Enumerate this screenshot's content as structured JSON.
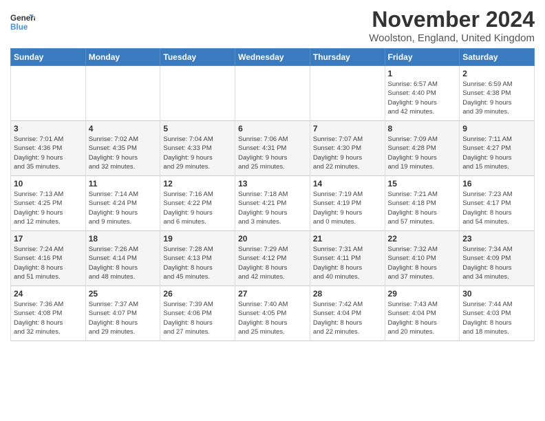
{
  "header": {
    "logo_line1": "General",
    "logo_line2": "Blue",
    "title": "November 2024",
    "subtitle": "Woolston, England, United Kingdom"
  },
  "days_of_week": [
    "Sunday",
    "Monday",
    "Tuesday",
    "Wednesday",
    "Thursday",
    "Friday",
    "Saturday"
  ],
  "weeks": [
    [
      {
        "day": "",
        "info": ""
      },
      {
        "day": "",
        "info": ""
      },
      {
        "day": "",
        "info": ""
      },
      {
        "day": "",
        "info": ""
      },
      {
        "day": "",
        "info": ""
      },
      {
        "day": "1",
        "info": "Sunrise: 6:57 AM\nSunset: 4:40 PM\nDaylight: 9 hours\nand 42 minutes."
      },
      {
        "day": "2",
        "info": "Sunrise: 6:59 AM\nSunset: 4:38 PM\nDaylight: 9 hours\nand 39 minutes."
      }
    ],
    [
      {
        "day": "3",
        "info": "Sunrise: 7:01 AM\nSunset: 4:36 PM\nDaylight: 9 hours\nand 35 minutes."
      },
      {
        "day": "4",
        "info": "Sunrise: 7:02 AM\nSunset: 4:35 PM\nDaylight: 9 hours\nand 32 minutes."
      },
      {
        "day": "5",
        "info": "Sunrise: 7:04 AM\nSunset: 4:33 PM\nDaylight: 9 hours\nand 29 minutes."
      },
      {
        "day": "6",
        "info": "Sunrise: 7:06 AM\nSunset: 4:31 PM\nDaylight: 9 hours\nand 25 minutes."
      },
      {
        "day": "7",
        "info": "Sunrise: 7:07 AM\nSunset: 4:30 PM\nDaylight: 9 hours\nand 22 minutes."
      },
      {
        "day": "8",
        "info": "Sunrise: 7:09 AM\nSunset: 4:28 PM\nDaylight: 9 hours\nand 19 minutes."
      },
      {
        "day": "9",
        "info": "Sunrise: 7:11 AM\nSunset: 4:27 PM\nDaylight: 9 hours\nand 15 minutes."
      }
    ],
    [
      {
        "day": "10",
        "info": "Sunrise: 7:13 AM\nSunset: 4:25 PM\nDaylight: 9 hours\nand 12 minutes."
      },
      {
        "day": "11",
        "info": "Sunrise: 7:14 AM\nSunset: 4:24 PM\nDaylight: 9 hours\nand 9 minutes."
      },
      {
        "day": "12",
        "info": "Sunrise: 7:16 AM\nSunset: 4:22 PM\nDaylight: 9 hours\nand 6 minutes."
      },
      {
        "day": "13",
        "info": "Sunrise: 7:18 AM\nSunset: 4:21 PM\nDaylight: 9 hours\nand 3 minutes."
      },
      {
        "day": "14",
        "info": "Sunrise: 7:19 AM\nSunset: 4:19 PM\nDaylight: 9 hours\nand 0 minutes."
      },
      {
        "day": "15",
        "info": "Sunrise: 7:21 AM\nSunset: 4:18 PM\nDaylight: 8 hours\nand 57 minutes."
      },
      {
        "day": "16",
        "info": "Sunrise: 7:23 AM\nSunset: 4:17 PM\nDaylight: 8 hours\nand 54 minutes."
      }
    ],
    [
      {
        "day": "17",
        "info": "Sunrise: 7:24 AM\nSunset: 4:16 PM\nDaylight: 8 hours\nand 51 minutes."
      },
      {
        "day": "18",
        "info": "Sunrise: 7:26 AM\nSunset: 4:14 PM\nDaylight: 8 hours\nand 48 minutes."
      },
      {
        "day": "19",
        "info": "Sunrise: 7:28 AM\nSunset: 4:13 PM\nDaylight: 8 hours\nand 45 minutes."
      },
      {
        "day": "20",
        "info": "Sunrise: 7:29 AM\nSunset: 4:12 PM\nDaylight: 8 hours\nand 42 minutes."
      },
      {
        "day": "21",
        "info": "Sunrise: 7:31 AM\nSunset: 4:11 PM\nDaylight: 8 hours\nand 40 minutes."
      },
      {
        "day": "22",
        "info": "Sunrise: 7:32 AM\nSunset: 4:10 PM\nDaylight: 8 hours\nand 37 minutes."
      },
      {
        "day": "23",
        "info": "Sunrise: 7:34 AM\nSunset: 4:09 PM\nDaylight: 8 hours\nand 34 minutes."
      }
    ],
    [
      {
        "day": "24",
        "info": "Sunrise: 7:36 AM\nSunset: 4:08 PM\nDaylight: 8 hours\nand 32 minutes."
      },
      {
        "day": "25",
        "info": "Sunrise: 7:37 AM\nSunset: 4:07 PM\nDaylight: 8 hours\nand 29 minutes."
      },
      {
        "day": "26",
        "info": "Sunrise: 7:39 AM\nSunset: 4:06 PM\nDaylight: 8 hours\nand 27 minutes."
      },
      {
        "day": "27",
        "info": "Sunrise: 7:40 AM\nSunset: 4:05 PM\nDaylight: 8 hours\nand 25 minutes."
      },
      {
        "day": "28",
        "info": "Sunrise: 7:42 AM\nSunset: 4:04 PM\nDaylight: 8 hours\nand 22 minutes."
      },
      {
        "day": "29",
        "info": "Sunrise: 7:43 AM\nSunset: 4:04 PM\nDaylight: 8 hours\nand 20 minutes."
      },
      {
        "day": "30",
        "info": "Sunrise: 7:44 AM\nSunset: 4:03 PM\nDaylight: 8 hours\nand 18 minutes."
      }
    ]
  ]
}
